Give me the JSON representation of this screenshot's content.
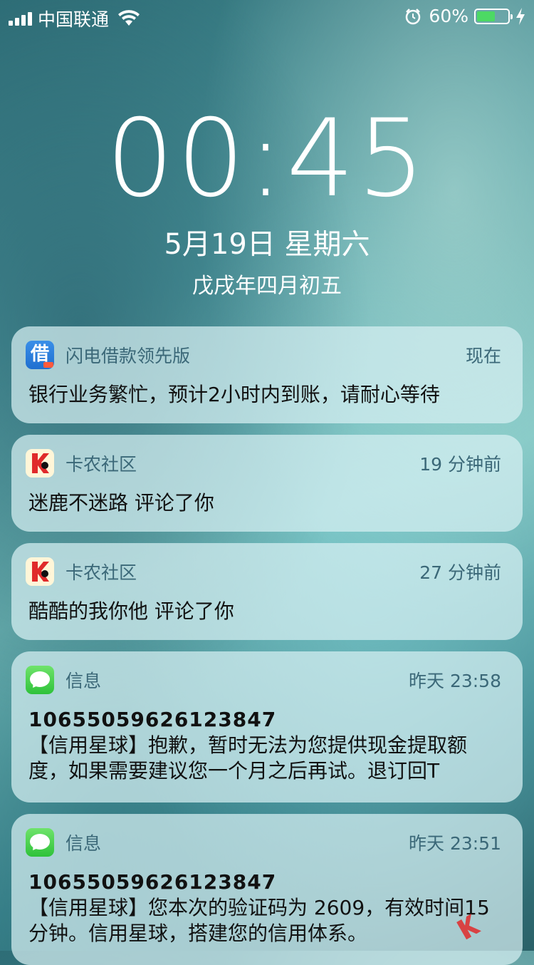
{
  "status_bar": {
    "carrier": "中国联通",
    "battery_percent_text": "60%",
    "battery_level": 0.6
  },
  "lockscreen": {
    "time": "00:45",
    "date": "5月19日 星期六",
    "lunar_date": "戊戌年四月初五"
  },
  "notifications": [
    {
      "app": "闪电借款领先版",
      "time": "现在",
      "body": "银行业务繁忙，预计2小时内到账，请耐心等待",
      "icon": "jie-app-icon"
    },
    {
      "app": "卡农社区",
      "time": "19 分钟前",
      "body": "迷鹿不迷路 评论了你",
      "icon": "kanong-app-icon"
    },
    {
      "app": "卡农社区",
      "time": "27 分钟前",
      "body": "酷酷的我你他 评论了你",
      "icon": "kanong-app-icon"
    },
    {
      "app": "信息",
      "time": "昨天 23:58",
      "sender": "10655059626123847",
      "body": "【信用星球】抱歉，暂时无法为您提供现金提取额度，如果需要建议您一个月之后再试。退订回T",
      "icon": "messages-app-icon"
    },
    {
      "app": "信息",
      "time": "昨天 23:51",
      "sender": "10655059626123847",
      "body": "【信用星球】您本次的验证码为 2609，有效时间15 分钟。信用星球，搭建您的信用体系。",
      "icon": "messages-app-icon"
    }
  ],
  "watermark": {
    "text": "卡农社区"
  },
  "colors": {
    "battery_fill": "#4cd964",
    "app_name": "#3b6878"
  }
}
